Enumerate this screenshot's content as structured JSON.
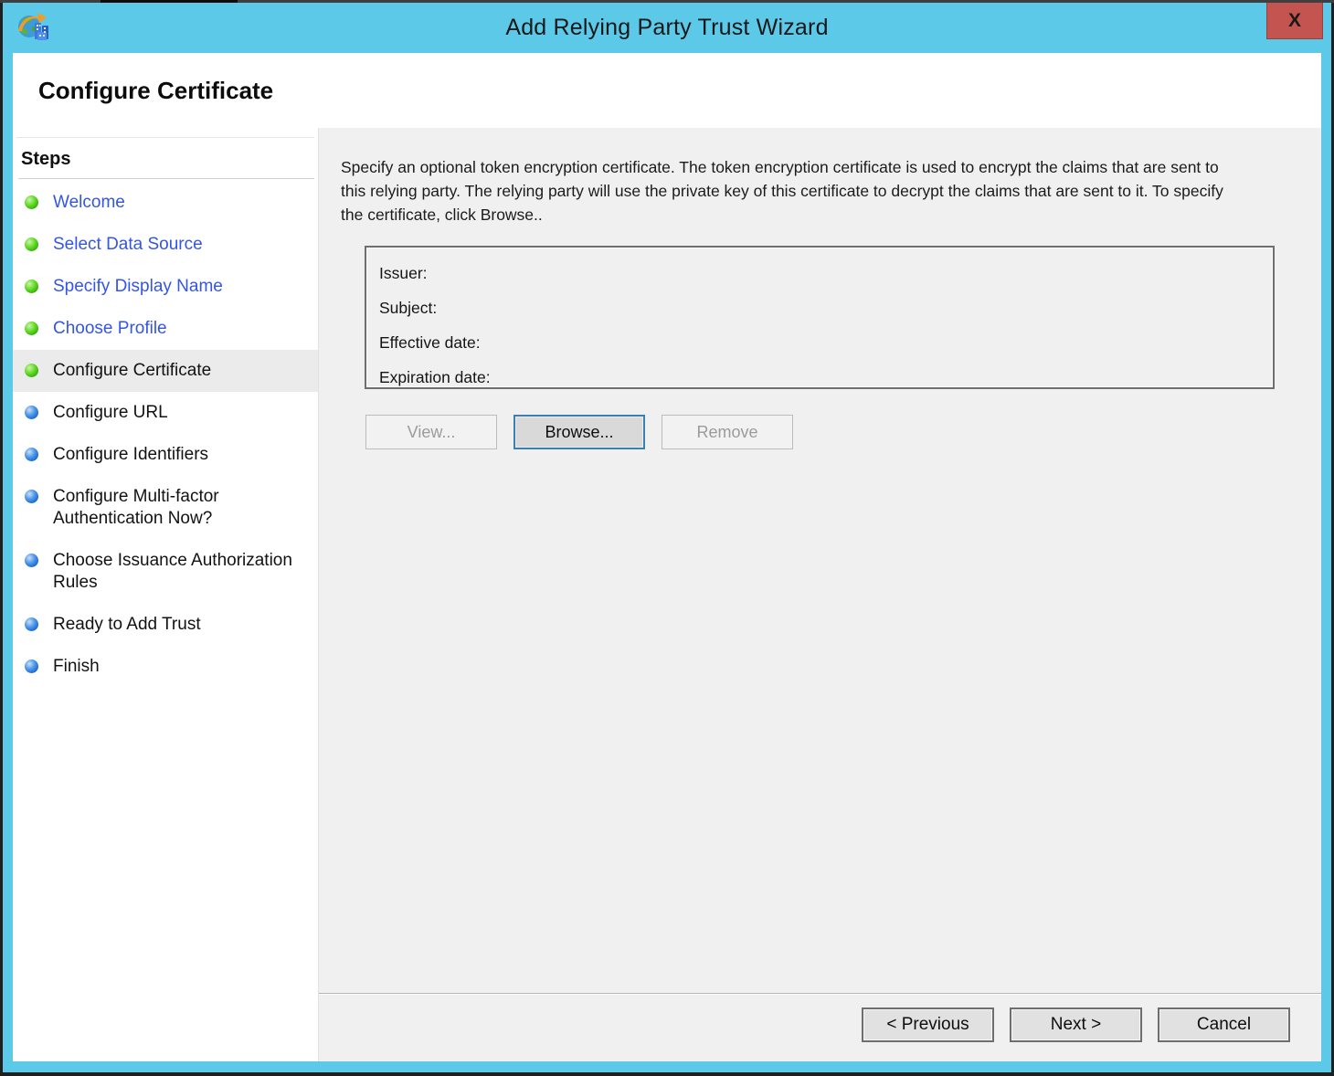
{
  "window": {
    "title": "Add Relying Party Trust Wizard",
    "close_label": "X",
    "page_title": "Configure Certificate"
  },
  "sidebar": {
    "heading": "Steps",
    "items": [
      {
        "label": "Welcome",
        "state": "done"
      },
      {
        "label": "Select Data Source",
        "state": "done"
      },
      {
        "label": "Specify Display Name",
        "state": "done"
      },
      {
        "label": "Choose Profile",
        "state": "done"
      },
      {
        "label": "Configure Certificate",
        "state": "current"
      },
      {
        "label": "Configure URL",
        "state": "todo"
      },
      {
        "label": "Configure Identifiers",
        "state": "todo"
      },
      {
        "label": "Configure Multi-factor Authentication Now?",
        "state": "todo"
      },
      {
        "label": "Choose Issuance Authorization Rules",
        "state": "todo"
      },
      {
        "label": "Ready to Add Trust",
        "state": "todo"
      },
      {
        "label": "Finish",
        "state": "todo"
      }
    ]
  },
  "content": {
    "description": "Specify an optional token encryption certificate.  The token encryption certificate is used to encrypt the claims that are sent to this relying party.  The relying party will use the private key of this certificate to decrypt the claims that are sent to it.  To specify the certificate, click Browse..",
    "certificate_fields": [
      {
        "label": "Issuer:",
        "value": ""
      },
      {
        "label": "Subject:",
        "value": ""
      },
      {
        "label": "Effective date:",
        "value": ""
      },
      {
        "label": "Expiration date:",
        "value": ""
      }
    ],
    "buttons": {
      "view": "View...",
      "browse": "Browse...",
      "remove": "Remove"
    }
  },
  "footer": {
    "previous": "< Previous",
    "next": "Next >",
    "cancel": "Cancel"
  },
  "colors": {
    "titlebar_blue": "#5CC9E9",
    "close_button_red": "#C4544F",
    "step_link_blue": "#3355E8",
    "step_done_bullet_green": "#2FAE07",
    "step_todo_bullet_blue": "#1566CE",
    "panel_gray": "#F0F0F0",
    "browse_focus_border": "#3C7FB1"
  }
}
